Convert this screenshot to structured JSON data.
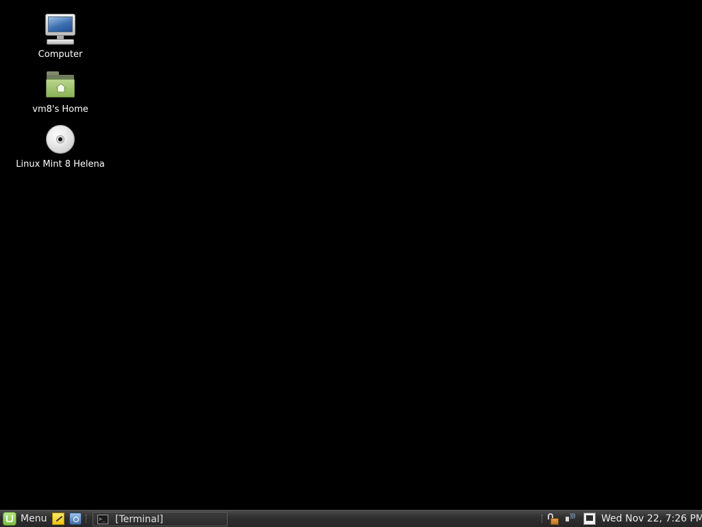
{
  "desktop": {
    "background_color": "#000000",
    "icons": [
      {
        "label": "Computer",
        "icon": "computer-icon"
      },
      {
        "label": "vm8's Home",
        "icon": "home-folder-icon"
      },
      {
        "label": "Linux Mint 8 Helena",
        "icon": "cd-disc-icon"
      }
    ]
  },
  "panel": {
    "menu_label": "Menu",
    "launchers": [
      {
        "icon": "text-editor-icon"
      },
      {
        "icon": "screenshot-icon"
      }
    ],
    "tasks": [
      {
        "label": "[Terminal]",
        "icon": "terminal-icon"
      }
    ],
    "tray": [
      {
        "icon": "lock-icon"
      },
      {
        "icon": "volume-icon"
      },
      {
        "icon": "network-icon"
      }
    ],
    "clock": "Wed Nov 22,  7:26 PM",
    "accent_color": "#8bc34a"
  }
}
